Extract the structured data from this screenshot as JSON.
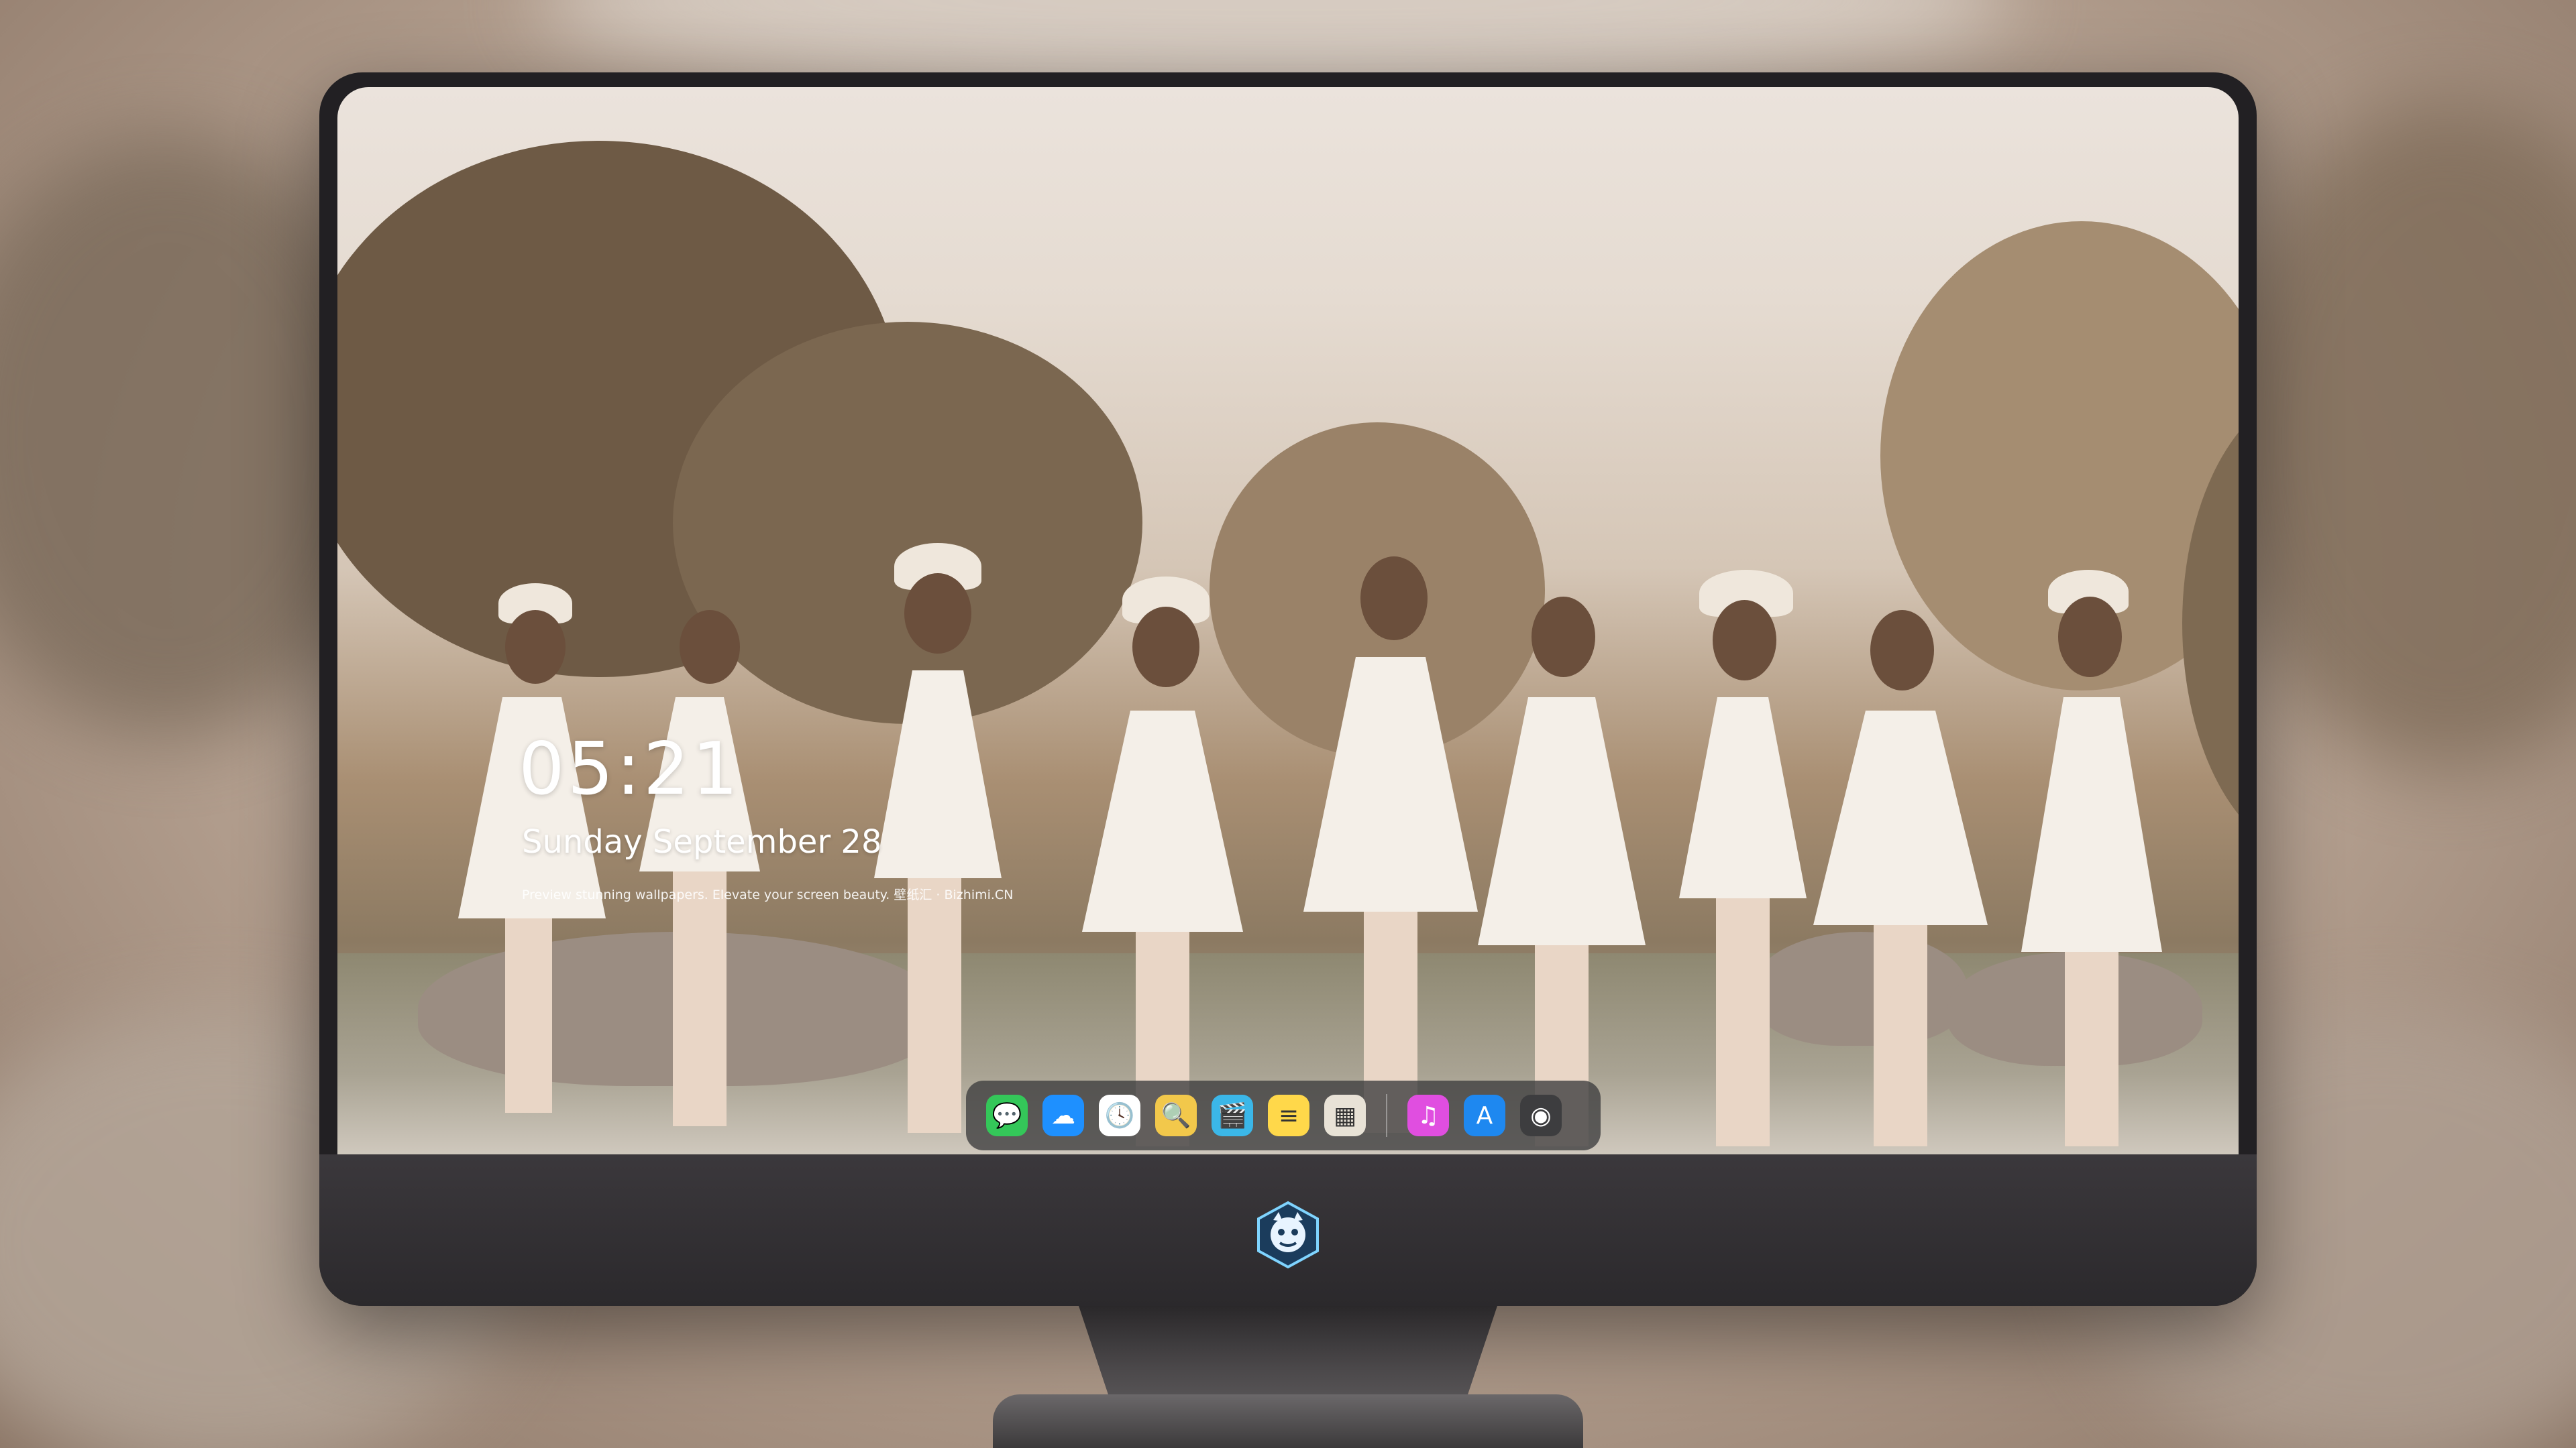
{
  "lock_screen": {
    "time": "05:21",
    "date": "Sunday September 28",
    "tagline": "Preview stunning wallpapers. Elevate your screen beauty. 壁纸汇 · Bizhimi.CN"
  },
  "dock": {
    "apps": [
      {
        "name": "messages-icon",
        "glyph": "💬",
        "color": "#34c759"
      },
      {
        "name": "weather-icon",
        "glyph": "☁",
        "color": "#1e90ff"
      },
      {
        "name": "clock-icon",
        "glyph": "🕓",
        "color": "#ffffff"
      },
      {
        "name": "preview-icon",
        "glyph": "🔍",
        "color": "#f2c84b"
      },
      {
        "name": "clips-icon",
        "glyph": "🎬",
        "color": "#3bb7e8"
      },
      {
        "name": "notes-icon",
        "glyph": "≡",
        "color": "#ffd84a"
      },
      {
        "name": "photo-booth-icon",
        "glyph": "▦",
        "color": "#e8e2d6"
      },
      {
        "name": "music-icon",
        "glyph": "♫",
        "color": "#e04ee0"
      },
      {
        "name": "app-store-icon",
        "glyph": "A",
        "color": "#1e88f0"
      },
      {
        "name": "camera-icon",
        "glyph": "◉",
        "color": "#3d3d3f"
      }
    ]
  },
  "monitor": {
    "logo": "monster-logo-icon"
  }
}
